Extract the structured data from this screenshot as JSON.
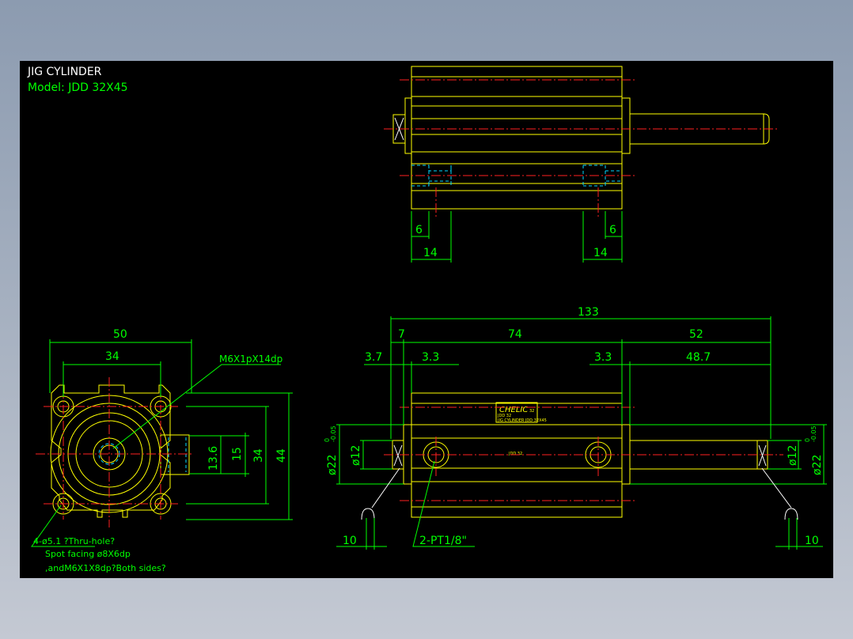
{
  "title": {
    "line1": "JIG CYLINDER",
    "line2": "Model:  JDD  32X45"
  },
  "colors": {
    "background": "#000000",
    "outline": "#ffff00",
    "dimension": "#00ff00",
    "centerline": "#ff2020",
    "hidden": "#00d8ff"
  },
  "top_view": {
    "dims": [
      "6",
      "14",
      "6",
      "14"
    ]
  },
  "end_view": {
    "dims": [
      "50",
      "34",
      "13.6",
      "15",
      "34",
      "44"
    ],
    "thread_callout": "M6X1pX14dp",
    "note_line1": "4-ø5.1 ?Thru-hole?",
    "note_line2": "Spot facing ø8X6dp",
    "note_line3": ",andM6X1X8dp?Both sides?"
  },
  "side_view": {
    "dims_top": [
      "133",
      "7",
      "74",
      "52",
      "3.7",
      "3.3",
      "3.3",
      "48.7"
    ],
    "left_dia": "ø22",
    "left_tol_upper": "0",
    "left_tol_lower": "-0.05",
    "left_bore": "ø12",
    "right_dia": "ø22",
    "right_tol_upper": "0",
    "right_tol_lower": "-0.05",
    "right_bore": "ø12",
    "port_callout": "2-PT1/8\"",
    "dim_left_bottom": "10",
    "dim_right_bottom": "10",
    "brand": "CHELIC",
    "brand_small": "32",
    "label_line1": "JDD 32",
    "label_line2": "JIG CYLINDER  JDD 32X45",
    "body_label": "JDD  32"
  }
}
